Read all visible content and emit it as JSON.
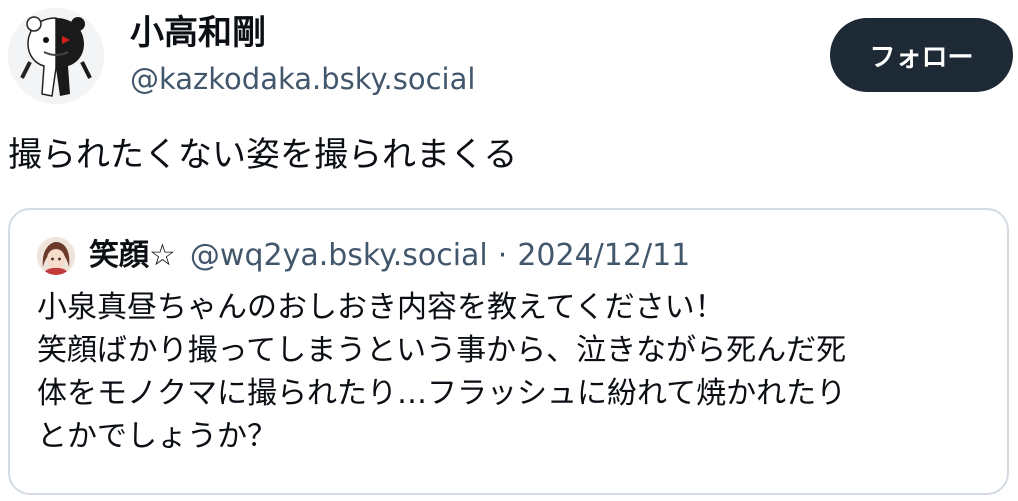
{
  "author": {
    "display_name": "小高和剛",
    "handle": "@kazkodaka.bsky.social",
    "avatar_icon": "monokuma-avatar-icon"
  },
  "actions": {
    "follow_label": "フォロー"
  },
  "post": {
    "text": "撮られたくない姿を撮られまくる"
  },
  "quote": {
    "display_name": "笑顔☆",
    "handle": "@wq2ya.bsky.social",
    "separator": "·",
    "date": "2024/12/11",
    "avatar_icon": "user-avatar-icon",
    "body_lines": [
      "小泉真昼ちゃんのおしおき内容を教えてください！",
      "笑顔ばかり撮ってしまうという事から、泣きながら死んだ死",
      "体をモノクマに撮られたり…フラッシュに紛れて焼かれたり",
      "とかでしょうか？"
    ]
  },
  "colors": {
    "text_primary": "#0b0f14",
    "text_secondary": "#42576c",
    "button_bg": "#1e2936",
    "card_border": "#d4dbe2"
  }
}
